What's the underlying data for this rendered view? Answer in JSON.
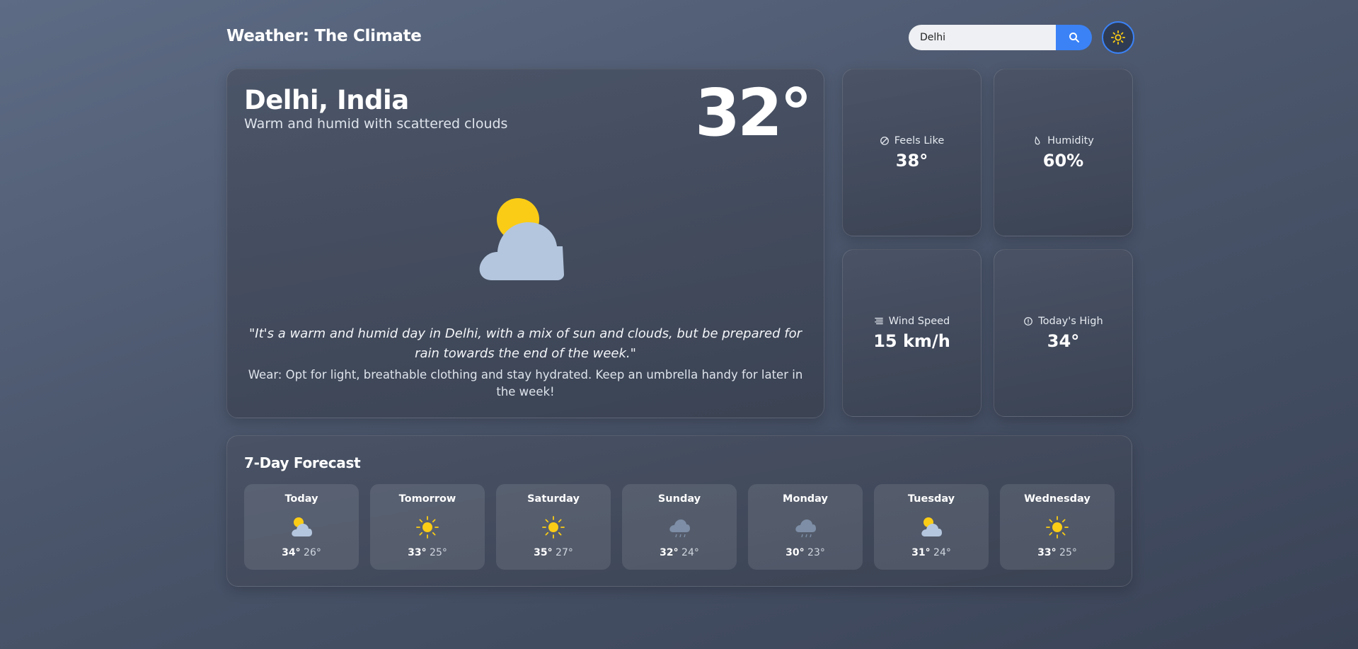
{
  "header": {
    "title": "Weather: The Climate",
    "search_value": "Delhi",
    "search_icon": "search-icon",
    "theme_icon": "sun-icon"
  },
  "current": {
    "location": "Delhi, India",
    "description": "Warm and humid with scattered clouds",
    "temperature": "32°",
    "icon": "partly-cloudy-icon",
    "quote": "\"It's a warm and humid day in Delhi, with a mix of sun and clouds, but be prepared for rain towards the end of the week.\"",
    "wear": "Wear: Opt for light, breathable clothing and stay hydrated. Keep an umbrella handy for later in the week!"
  },
  "stats": [
    {
      "label": "Feels Like",
      "value": "38°",
      "icon": "thermometer-icon"
    },
    {
      "label": "Humidity",
      "value": "60%",
      "icon": "droplet-icon"
    },
    {
      "label": "Wind Speed",
      "value": "15 km/h",
      "icon": "wind-icon"
    },
    {
      "label": "Today's High",
      "value": "34°",
      "icon": "info-icon"
    }
  ],
  "forecast": {
    "title": "7-Day Forecast",
    "days": [
      {
        "day": "Today",
        "high": "34°",
        "low": "26°",
        "icon": "partly-cloudy-icon"
      },
      {
        "day": "Tomorrow",
        "high": "33°",
        "low": "25°",
        "icon": "sun-icon"
      },
      {
        "day": "Saturday",
        "high": "35°",
        "low": "27°",
        "icon": "sun-icon"
      },
      {
        "day": "Sunday",
        "high": "32°",
        "low": "24°",
        "icon": "rain-cloud-icon"
      },
      {
        "day": "Monday",
        "high": "30°",
        "low": "23°",
        "icon": "rain-cloud-icon"
      },
      {
        "day": "Tuesday",
        "high": "31°",
        "low": "24°",
        "icon": "partly-cloudy-icon"
      },
      {
        "day": "Wednesday",
        "high": "33°",
        "low": "25°",
        "icon": "sun-icon"
      }
    ]
  },
  "colors": {
    "accent": "#3b82f6",
    "sun": "#facc15",
    "cloud": "#b4c6de",
    "rain_cloud": "#7d8ea6"
  }
}
